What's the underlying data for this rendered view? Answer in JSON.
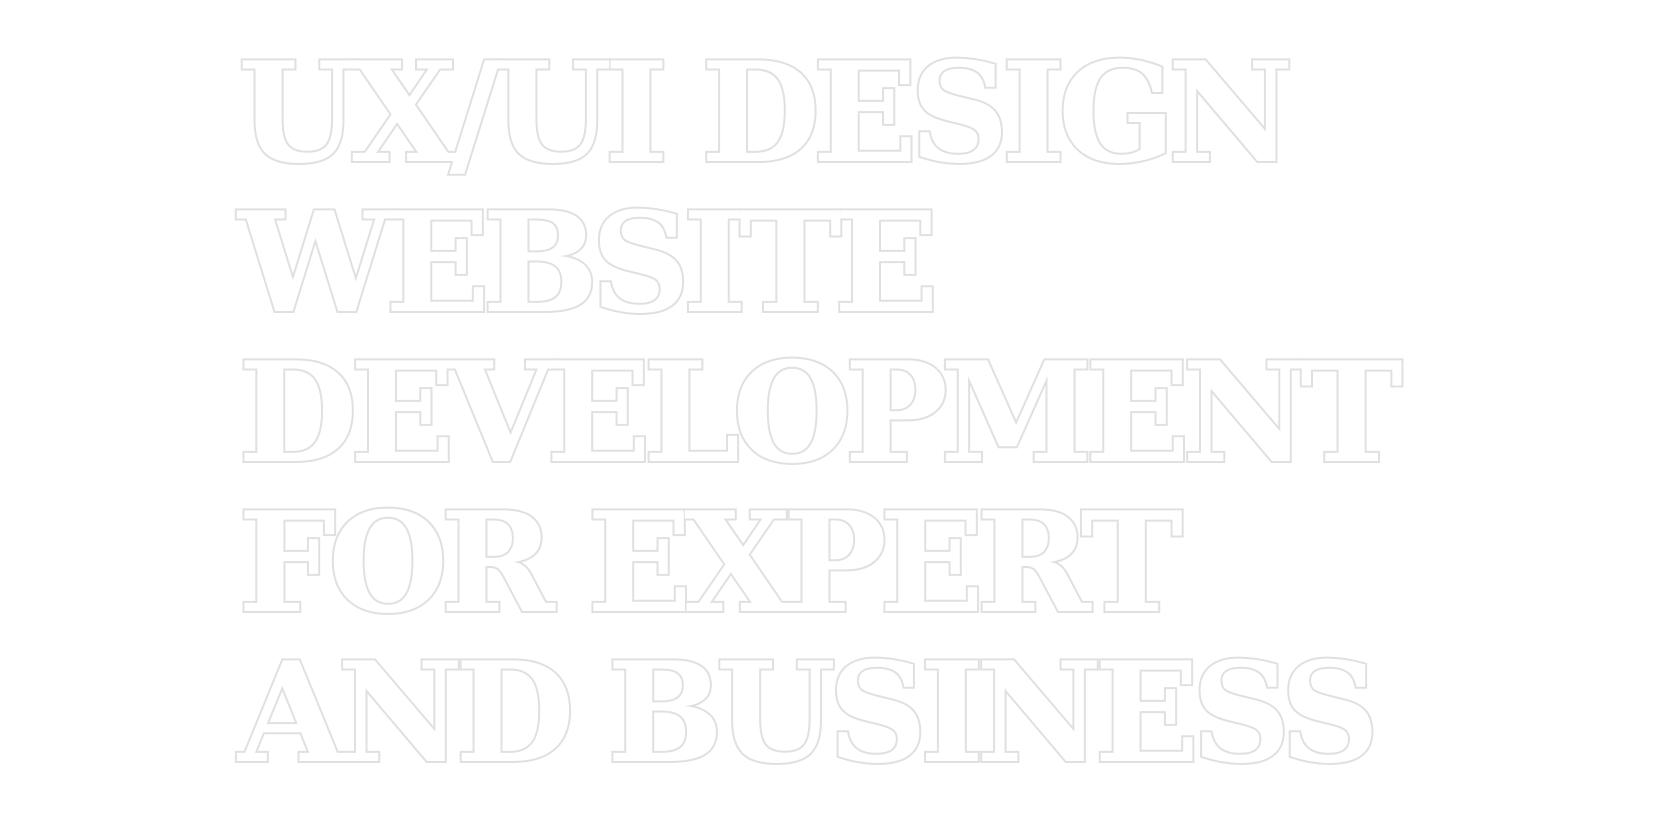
{
  "headline": {
    "lines": [
      "UX/UI DESIGN",
      "WEBSITE",
      "DEVELOPMENT",
      "FOR EXPERT",
      "AND BUSINESS"
    ]
  },
  "colors": {
    "background": "#ffffff",
    "text_outline": "#e0e0e0",
    "text_fill": "#ffffff"
  }
}
